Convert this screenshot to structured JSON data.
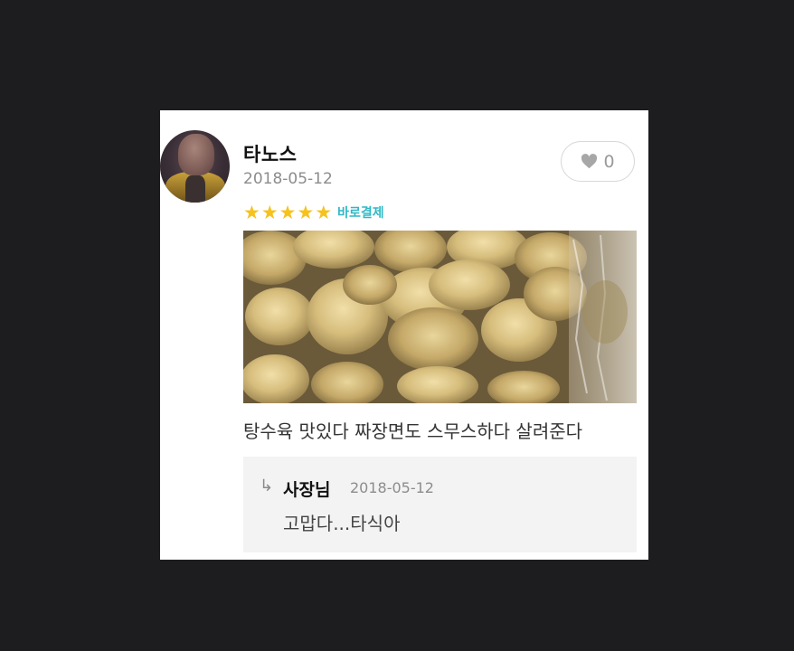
{
  "review": {
    "username": "타노스",
    "date": "2018-05-12",
    "like_count": "0",
    "stars": [
      "★",
      "★",
      "★",
      "★",
      "★"
    ],
    "rating_value": 5,
    "purchase_badge": "바로결제",
    "text": "탕수육 맛있다 짜장면도 스무스하다 살려준다",
    "photo_label": "fried-pork-photo"
  },
  "reply": {
    "arrow": "↳",
    "author": "사장님",
    "date": "2018-05-12",
    "text": "고맙다...타식아"
  },
  "colors": {
    "background": "#1d1c1e",
    "card": "#ffffff",
    "star": "#f6c21c",
    "badge": "#2fb8c5",
    "reply_bg": "#f3f3f3"
  }
}
